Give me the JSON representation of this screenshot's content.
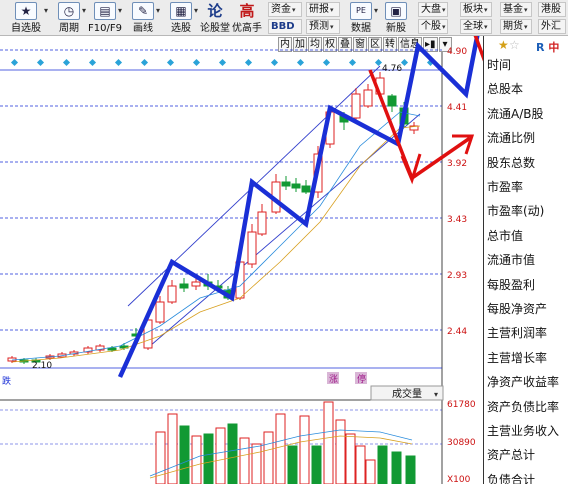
{
  "toolbar": {
    "buttons": [
      {
        "label": "自选股",
        "icon": "star-icon"
      },
      {
        "label": "周期",
        "icon": "clock-icon"
      },
      {
        "label": "F10/F9",
        "icon": "document-icon"
      },
      {
        "label": "画线",
        "icon": "pencil-icon"
      },
      {
        "label": "选股",
        "icon": "screen-icon"
      },
      {
        "label": "论股堂",
        "icon": "lun-icon",
        "glyph": "论"
      },
      {
        "label": "优高手",
        "icon": "gao-icon",
        "glyph": "高"
      }
    ],
    "small_buttons": [
      "资金",
      "研报",
      "BBD",
      "预测",
      "数据",
      "新股",
      "大盘",
      "板块",
      "基金",
      "港股",
      "个股",
      "全球",
      "期货",
      "外汇"
    ],
    "pe_badge": "PE"
  },
  "period_tabs": [
    "内",
    "加",
    "均",
    "权",
    "叠",
    "窗",
    "区",
    "转",
    "信息"
  ],
  "chart": {
    "price_labels": [
      "4.90",
      "4.41",
      "3.92",
      "3.43",
      "2.93",
      "2.44"
    ],
    "high_label": "4.76",
    "low_label": "2.10",
    "volume_labels": [
      "61780",
      "30890",
      "X100"
    ],
    "indicator_selector": "成交量",
    "markers": [
      "涨",
      "停"
    ],
    "left_marker": "跌"
  },
  "info_panel": {
    "brand": "中",
    "items": [
      "时间",
      "总股本",
      "流通A/B股",
      "流通比例",
      "股东总数",
      "市盈率",
      "市盈率(动)",
      "总市值",
      "流通市值",
      "每股盈利",
      "每股净资产",
      "主营利润率",
      "主营增长率",
      "净资产收益率",
      "资产负债比率",
      "主营业务收入",
      "资产总计",
      "负债合计"
    ]
  },
  "colors": {
    "up": "#dd2222",
    "down": "#119933",
    "trend_up": "#1a2fd6",
    "trend_down": "#e01010",
    "channel": "#3340cc"
  }
}
